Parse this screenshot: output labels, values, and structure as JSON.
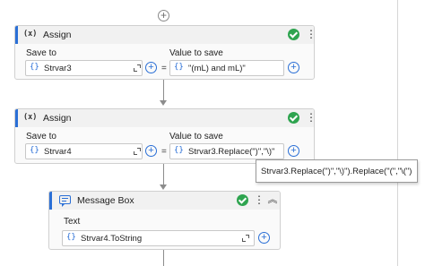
{
  "workflow": {
    "add_activity_icon": "plus-circle-icon",
    "activities": [
      {
        "type_glyph": "(x)",
        "title": "Assign",
        "status_icon": "check-circle-icon",
        "status_color": "#2ea44f",
        "save_to_label": "Save to",
        "save_to_value": "Strvar3",
        "value_label": "Value to save",
        "value": "\"(mL) and mL)\""
      },
      {
        "type_glyph": "(x)",
        "title": "Assign",
        "status_icon": "check-circle-icon",
        "status_color": "#2ea44f",
        "save_to_label": "Save to",
        "save_to_value": "Strvar4",
        "value_label": "Value to save",
        "value": "Strvar3.Replace(\")\",\"\\)\""
      },
      {
        "type_glyph": "message-box-icon",
        "title": "Message Box",
        "status_icon": "check-circle-icon",
        "status_color": "#2ea44f",
        "text_label": "Text",
        "text_value": "Strvar4.ToString"
      }
    ],
    "tooltip": "Strvar3.Replace(\")\",\"\\)\").Replace(\"(\",\"\\(\")"
  },
  "braces_glyph": "{}",
  "equals_glyph": "=",
  "accent_color": "#2a6fd6"
}
